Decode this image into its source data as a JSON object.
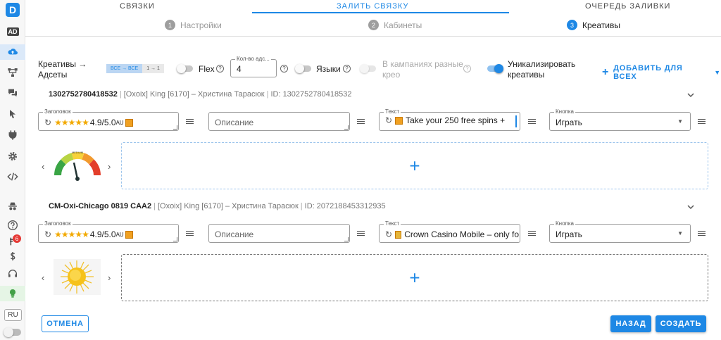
{
  "sidebar": {
    "logo": "D",
    "ad": "AD",
    "badge": "6",
    "lang": "RU",
    "icons": [
      "cloud-upload-icon",
      "hierarchy-icon",
      "chat-icon",
      "cursor-icon",
      "plug-icon",
      "gear-icon",
      "code-icon",
      "spy-icon",
      "help-icon",
      "finance-icon",
      "dollar-icon",
      "headset-icon",
      "bulb-icon"
    ]
  },
  "tabs": [
    {
      "label": "СВЯЗКИ"
    },
    {
      "label": "ЗАЛИТЬ СВЯЗКУ"
    },
    {
      "label": "ОЧЕРЕДЬ ЗАЛИВКИ"
    }
  ],
  "steps": [
    {
      "num": "1",
      "label": "Настройки"
    },
    {
      "num": "2",
      "label": "Кабинеты"
    },
    {
      "num": "3",
      "label": "Креативы"
    }
  ],
  "options": {
    "mapping_label": "Креативы →",
    "mapping_label2": "Адсеты",
    "chip_all": "ВСЕ → ВСЕ",
    "chip_one": "1 → 1",
    "flex_label": "Flex",
    "count_label": "Кол-во адс...",
    "count_value": "4",
    "languages_label": "Языки",
    "diff_creo_label": "В кампаниях разные",
    "diff_creo_label2": "крео",
    "unique_label": "Уникализировать",
    "unique_label2": "креативы",
    "add_all": "ДОБАВИТЬ ДЛЯ ВСЕХ"
  },
  "items": [
    {
      "name": "1302752780418532",
      "account": "[Oxoix] King [6170] – Христина Тарасюк",
      "id_text": "ID: 1302752780418532",
      "headline_label": "Заголовок",
      "headline_rating": "4.9/5.0",
      "headline_suffix": "AU",
      "description_placeholder": "Описание",
      "text_label": "Текст",
      "text_value": "Take your 250 free spins +",
      "button_label": "Кнопка",
      "button_value": "Играть"
    },
    {
      "name": "CM-Oxi-Chicago 0819 CAA2",
      "account": "[Oxoix] King [6170] – Христина Тарасюк",
      "id_text": "ID: 2072188453312935",
      "headline_label": "Заголовок",
      "headline_rating": "4.9/5.0",
      "headline_suffix": "AU",
      "description_placeholder": "Описание",
      "text_label": "Текст",
      "text_value": "Crown Casino Mobile – only fo",
      "button_label": "Кнопка",
      "button_value": "Играть"
    }
  ],
  "gauge_label": "MEDIUM",
  "footer": {
    "cancel": "ОТМЕНА",
    "back": "НАЗАД",
    "create": "СОЗДАТЬ"
  },
  "colors": {
    "accent": "#1e88e5",
    "sidebar_bg": "#f7f7f7"
  }
}
